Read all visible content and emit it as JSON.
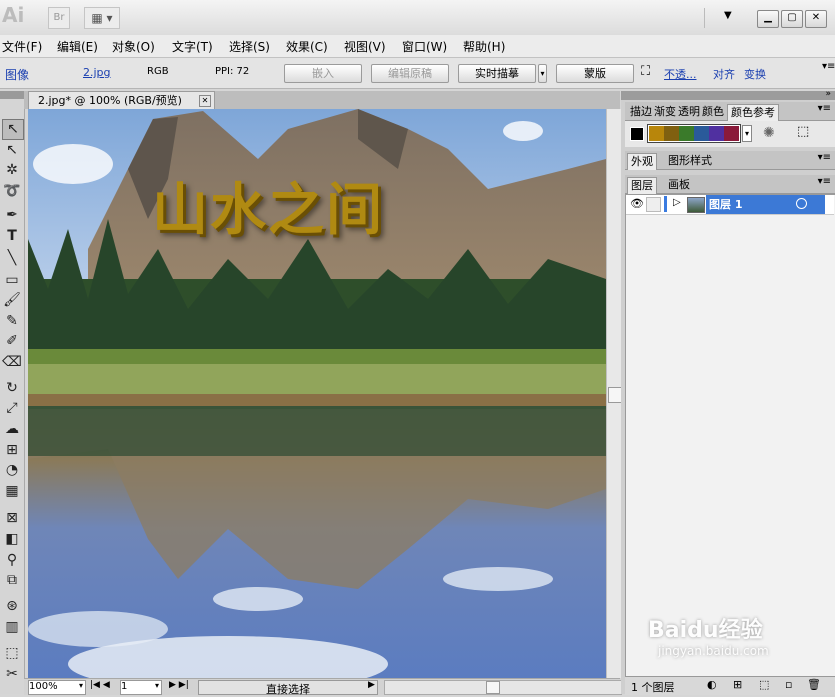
{
  "app": {
    "logo_text": "Ai",
    "bridge_label": "Br"
  },
  "menu": [
    {
      "label": "文件(F)"
    },
    {
      "label": "编辑(E)"
    },
    {
      "label": "对象(O)"
    },
    {
      "label": "文字(T)"
    },
    {
      "label": "选择(S)"
    },
    {
      "label": "效果(C)"
    },
    {
      "label": "视图(V)"
    },
    {
      "label": "窗口(W)"
    },
    {
      "label": "帮助(H)"
    }
  ],
  "control": {
    "object_type": "图像",
    "file_name": "2.jpg",
    "color_mode": "RGB",
    "ppi": "PPI: 72",
    "embed": "嵌入",
    "edit_original": "编辑原稿",
    "live_trace": "实时描摹",
    "mask": "蒙版",
    "opacity": "不透...",
    "align": "对齐",
    "transform": "变换"
  },
  "document": {
    "tab_title": "2.jpg* @ 100% (RGB/预览)",
    "artwork_text": "山水之间"
  },
  "status": {
    "zoom": "100%",
    "artboard": "1",
    "tool_status": "直接选择"
  },
  "panels": {
    "top_tabs": [
      "描边",
      "渐变",
      "透明",
      "颜色",
      "颜色参考"
    ],
    "swatch_colors": [
      "#b8860b",
      "#806010",
      "#3a7a2a",
      "#2a5a9a",
      "#5030a0",
      "#8a1a3a"
    ],
    "appearance_tab": "外观",
    "graphic_styles_tab": "图形样式",
    "layers_tab": "图层",
    "artboards_tab": "画板",
    "layer_name": "图层 1",
    "layer_count": "1 个图层"
  },
  "watermark": {
    "brand": "Baidu经验",
    "url": "jingyan.baidu.com"
  }
}
